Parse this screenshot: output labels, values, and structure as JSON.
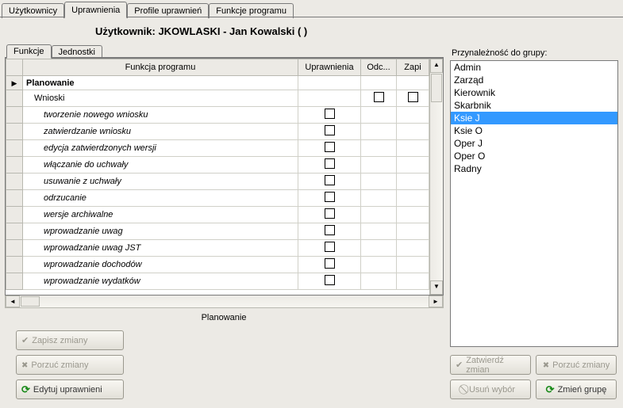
{
  "top_tabs": {
    "users": "Użytkownicy",
    "perms": "Uprawnienia",
    "profiles": "Profile uprawnień",
    "functions": "Funkcje programu"
  },
  "header": {
    "label": "Użytkownik: JKOWLASKI - Jan Kowalski ( )"
  },
  "inner_tabs": {
    "functions": "Funkcje",
    "units": "Jednostki"
  },
  "grid": {
    "columns": {
      "func": "Funkcja programu",
      "perm": "Uprawnienia",
      "odc": "Odc...",
      "zapi": "Zapi"
    },
    "rows": [
      {
        "label": "Planowanie",
        "level": 0,
        "bold": true,
        "perm": null,
        "odc": null,
        "zapi": null,
        "marker": true
      },
      {
        "label": "Wnioski",
        "level": 1,
        "bold": false,
        "perm": null,
        "odc": false,
        "zapi": false
      },
      {
        "label": "tworzenie nowego wniosku",
        "level": 2,
        "italic": true,
        "perm": false
      },
      {
        "label": "zatwierdzanie wniosku",
        "level": 2,
        "italic": true,
        "perm": false
      },
      {
        "label": "edycja zatwierdzonych wersji",
        "level": 2,
        "italic": true,
        "perm": false
      },
      {
        "label": "włączanie do uchwały",
        "level": 2,
        "italic": true,
        "perm": false
      },
      {
        "label": "usuwanie z uchwały",
        "level": 2,
        "italic": true,
        "perm": false
      },
      {
        "label": "odrzucanie",
        "level": 2,
        "italic": true,
        "perm": false
      },
      {
        "label": "wersje archiwalne",
        "level": 2,
        "italic": true,
        "perm": false
      },
      {
        "label": "wprowadzanie uwag",
        "level": 2,
        "italic": true,
        "perm": false
      },
      {
        "label": "wprowadzanie uwag JST",
        "level": 2,
        "italic": true,
        "perm": false
      },
      {
        "label": "wprowadzanie dochodów",
        "level": 2,
        "italic": true,
        "perm": false
      },
      {
        "label": "wprowadzanie wydatków",
        "level": 2,
        "italic": true,
        "perm": false
      }
    ],
    "selected_label": "Planowanie"
  },
  "groups": {
    "label": "Przynależność do grupy:",
    "items": [
      "Admin",
      "Zarząd",
      "Kierownik",
      "Skarbnik",
      "Ksie J",
      "Ksie O",
      "Oper J",
      "Oper O",
      "Radny"
    ],
    "selected": "Ksie J"
  },
  "buttons": {
    "save": "Zapisz zmiany",
    "discard": "Porzuć zmiany",
    "edit": "Edytuj uprawnieni",
    "confirm": "Zatwierdź zmian",
    "discard2": "Porzuć zmiany",
    "clear": "Usuń wybór",
    "change_group": "Zmień grupę"
  }
}
